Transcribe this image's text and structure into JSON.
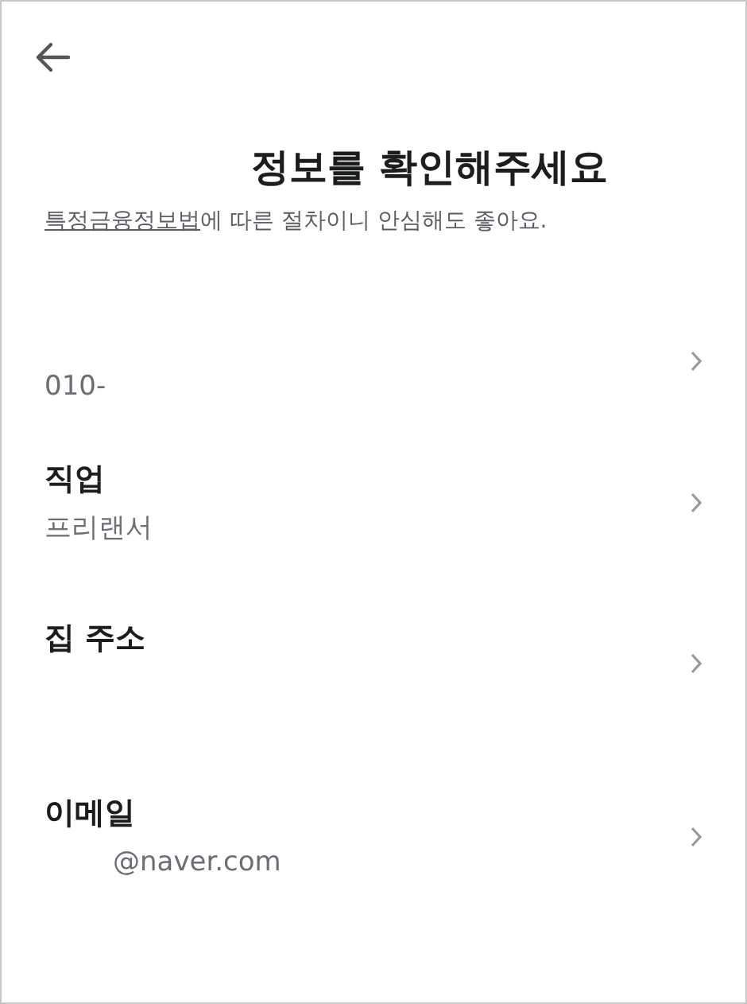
{
  "title": "정보를 확인해주세요",
  "subtitle": {
    "link": "특정금융정보법",
    "text": "에 따른 절차이니 안심해도 좋아요."
  },
  "items": [
    {
      "value": "010-"
    },
    {
      "label": "직업",
      "value": "프리랜서"
    },
    {
      "label": "집 주소"
    },
    {
      "label": "이메일",
      "value": "@naver.com"
    }
  ]
}
